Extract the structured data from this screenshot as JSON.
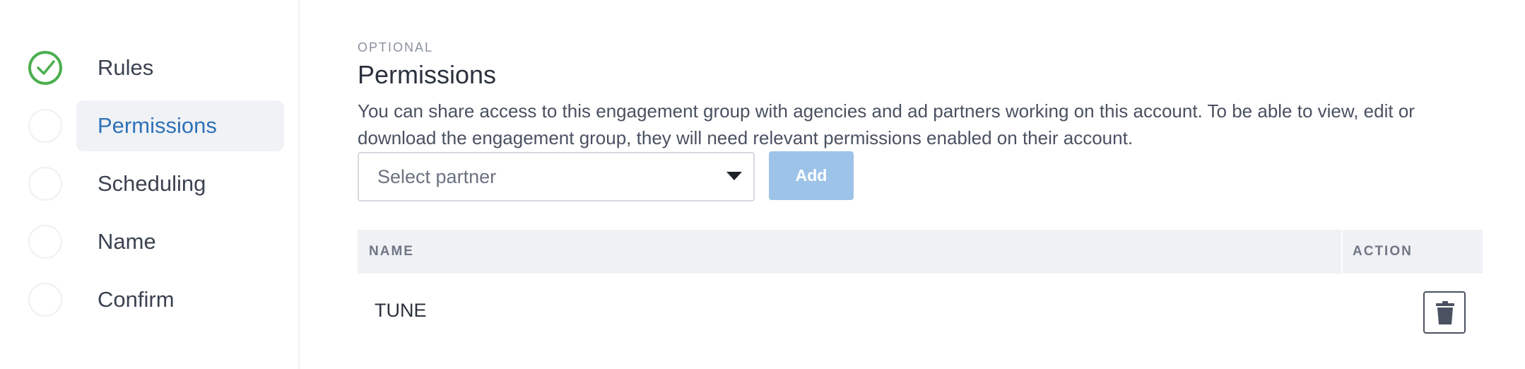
{
  "sidebar": {
    "steps": [
      {
        "label": "Rules",
        "status": "done"
      },
      {
        "label": "Permissions",
        "status": "active"
      },
      {
        "label": "Scheduling",
        "status": "pending"
      },
      {
        "label": "Name",
        "status": "pending"
      },
      {
        "label": "Confirm",
        "status": "pending"
      }
    ]
  },
  "main": {
    "eyebrow": "OPTIONAL",
    "title": "Permissions",
    "description": "You can share access to this engagement group with agencies and ad partners working on this account. To be able to view, edit or download the engagement group, they will need relevant permissions enabled on their account.",
    "partner_select": {
      "placeholder": "Select partner"
    },
    "add_button": "Add",
    "table": {
      "columns": {
        "name": "NAME",
        "action": "ACTION"
      },
      "rows": [
        {
          "name": "TUNE",
          "action_icon": "trash-icon"
        }
      ]
    }
  },
  "colors": {
    "accent": "#2f72b8",
    "success": "#4caf50",
    "add_button_bg": "#9dc3e8",
    "active_pill_bg": "#f0f2f6",
    "table_header_bg": "#f0f1f5"
  }
}
